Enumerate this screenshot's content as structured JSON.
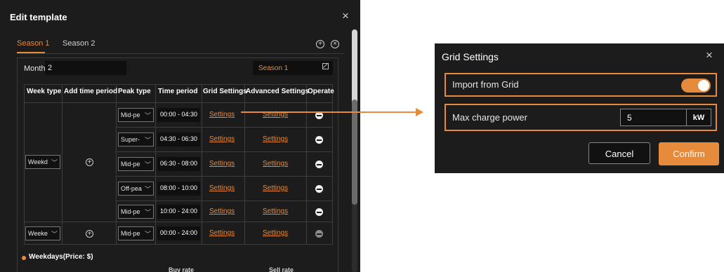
{
  "edit_template": {
    "title": "Edit template",
    "close_glyph": "×",
    "tabs": [
      "Season 1",
      "Season 2"
    ],
    "add_glyph": "+",
    "remove_glyph": "×",
    "month_label": "Month",
    "month_value": "2",
    "season_value": "Season 1",
    "columns": [
      "Week type",
      "Add time period",
      "Peak type",
      "Time period",
      "Grid Settings",
      "Advanced Settings",
      "Operate"
    ],
    "week_types": [
      "Weekd",
      "Weeke"
    ],
    "add_period_glyph": "+",
    "rows": [
      {
        "peak": "Mid-pe",
        "period": "00:00 - 04:30",
        "grid": "Settings",
        "advanced": "Settings"
      },
      {
        "peak": "Super-",
        "period": "04:30 - 06:30",
        "grid": "Settings",
        "advanced": "Settings"
      },
      {
        "peak": "Mid-pe",
        "period": "06:30 - 08:00",
        "grid": "Settings",
        "advanced": "Settings"
      },
      {
        "peak": "Off-pea",
        "period": "08:00 - 10:00",
        "grid": "Settings",
        "advanced": "Settings"
      },
      {
        "peak": "Mid-pe",
        "period": "10:00 - 24:00",
        "grid": "Settings",
        "advanced": "Settings"
      },
      {
        "peak": "Mid-pe",
        "period": "00:00 - 24:00",
        "grid": "Settings",
        "advanced": "Settings"
      }
    ],
    "legend": "Weekdays(Price: $)",
    "buy_rate": "Buy rate",
    "sell_rate": "Sell rate"
  },
  "grid_settings": {
    "title": "Grid Settings",
    "close_glyph": "×",
    "import_label": "Import from Grid",
    "import_enabled": true,
    "max_charge_label": "Max charge power",
    "max_charge_value": "5",
    "unit": "kW",
    "cancel_label": "Cancel",
    "confirm_label": "Confirm"
  },
  "colors": {
    "accent": "#e68a3c",
    "dialog_bg": "#1c1c1c"
  }
}
